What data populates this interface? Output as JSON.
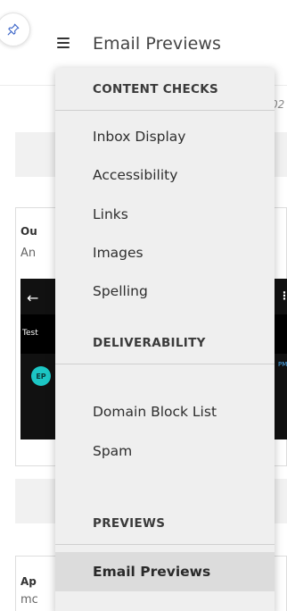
{
  "header": {
    "title": "Email Previews"
  },
  "background": {
    "date_fragment": "02",
    "card1": {
      "title_fragment": "Ou",
      "subtitle_fragment": "An"
    },
    "preview": {
      "subject_fragment": "Test",
      "avatar_initials": "EP",
      "time_fragment": "PM"
    },
    "card2": {
      "title_fragment": "Ap",
      "subtitle_fragment": "mc"
    }
  },
  "menu": {
    "sections": [
      {
        "heading": "CONTENT CHECKS",
        "items": [
          {
            "label": "Inbox Display",
            "active": false
          },
          {
            "label": "Accessibility",
            "active": false
          },
          {
            "label": "Links",
            "active": false
          },
          {
            "label": "Images",
            "active": false
          },
          {
            "label": "Spelling",
            "active": false
          }
        ]
      },
      {
        "heading": "DELIVERABILITY",
        "items": [
          {
            "label": "Domain Block List",
            "active": false
          },
          {
            "label": "Spam",
            "active": false
          }
        ]
      },
      {
        "heading": "PREVIEWS",
        "items": [
          {
            "label": "Email Previews",
            "active": true
          }
        ]
      }
    ]
  },
  "colors": {
    "avatar": "#1cc6c4",
    "menu_bg": "#efefef",
    "active_item_bg": "#dcdcdc"
  }
}
